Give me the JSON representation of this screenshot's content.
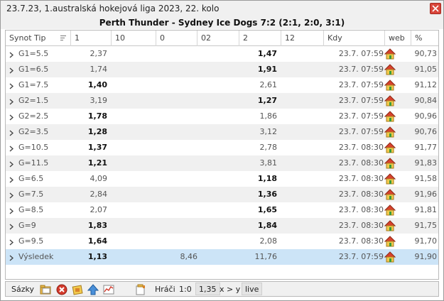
{
  "window": {
    "title": "23.7.23, 1.australská hokejová liga 2023, 22. kolo",
    "match": "Perth Thunder - Sydney Ice Dogs 7:2 (2:1, 2:0, 3:1)"
  },
  "columns": [
    "Synot Tip",
    "1",
    "10",
    "0",
    "02",
    "2",
    "12",
    "Kdy",
    "web",
    "%"
  ],
  "rows": [
    {
      "tip": "G1=5.5",
      "c1": "2,37",
      "c1b": false,
      "c0": "",
      "c2": "1,47",
      "c2b": true,
      "kdy": "23.7. 07:59",
      "pct": "90,73"
    },
    {
      "tip": "G1=6.5",
      "c1": "1,74",
      "c1b": false,
      "c0": "",
      "c2": "1,91",
      "c2b": true,
      "kdy": "23.7. 07:59",
      "pct": "91,05"
    },
    {
      "tip": "G1=7.5",
      "c1": "1,40",
      "c1b": true,
      "c0": "",
      "c2": "2,61",
      "c2b": false,
      "kdy": "23.7. 07:59",
      "pct": "91,12"
    },
    {
      "tip": "G2=1.5",
      "c1": "3,19",
      "c1b": false,
      "c0": "",
      "c2": "1,27",
      "c2b": true,
      "kdy": "23.7. 07:59",
      "pct": "90,84"
    },
    {
      "tip": "G2=2.5",
      "c1": "1,78",
      "c1b": true,
      "c0": "",
      "c2": "1,86",
      "c2b": false,
      "kdy": "23.7. 07:59",
      "pct": "90,96"
    },
    {
      "tip": "G2=3.5",
      "c1": "1,28",
      "c1b": true,
      "c0": "",
      "c2": "3,12",
      "c2b": false,
      "kdy": "23.7. 07:59",
      "pct": "90,76"
    },
    {
      "tip": "G=10.5",
      "c1": "1,37",
      "c1b": true,
      "c0": "",
      "c2": "2,78",
      "c2b": false,
      "kdy": "23.7. 08:30",
      "pct": "91,77"
    },
    {
      "tip": "G=11.5",
      "c1": "1,21",
      "c1b": true,
      "c0": "",
      "c2": "3,81",
      "c2b": false,
      "kdy": "23.7. 08:30",
      "pct": "91,83"
    },
    {
      "tip": "G=6.5",
      "c1": "4,09",
      "c1b": false,
      "c0": "",
      "c2": "1,18",
      "c2b": true,
      "kdy": "23.7. 08:30",
      "pct": "91,58"
    },
    {
      "tip": "G=7.5",
      "c1": "2,84",
      "c1b": false,
      "c0": "",
      "c2": "1,36",
      "c2b": true,
      "kdy": "23.7. 08:30",
      "pct": "91,96"
    },
    {
      "tip": "G=8.5",
      "c1": "2,07",
      "c1b": false,
      "c0": "",
      "c2": "1,65",
      "c2b": true,
      "kdy": "23.7. 08:30",
      "pct": "91,81"
    },
    {
      "tip": "G=9",
      "c1": "1,83",
      "c1b": true,
      "c0": "",
      "c2": "1,84",
      "c2b": true,
      "kdy": "23.7. 08:30",
      "pct": "91,75"
    },
    {
      "tip": "G=9.5",
      "c1": "1,64",
      "c1b": true,
      "c0": "",
      "c2": "2,08",
      "c2b": false,
      "kdy": "23.7. 08:30",
      "pct": "91,70"
    },
    {
      "tip": "Výsledek",
      "c1": "1,13",
      "c1b": true,
      "c0": "8,46",
      "c2": "11,76",
      "c2b": false,
      "kdy": "23.7. 07:59",
      "pct": "91,90"
    }
  ],
  "icons": {
    "row_expand": "chevron-right-icon",
    "web_link": "home-icon",
    "sort": "sort-icon"
  },
  "bottom": {
    "sazky_label": "Sázky",
    "hraci_label": "Hráči",
    "ratio_label": "1:0",
    "ratio_value": "1,35",
    "xy_label": "x > y",
    "live_label": "live"
  },
  "colors": {
    "selected_row": "#cce4f7",
    "alt_row": "#f0f0f0",
    "close_button": "#d9463b",
    "house_roof": "#d8432d",
    "house_body": "#f2c94c",
    "house_door": "#3a9b3a"
  }
}
